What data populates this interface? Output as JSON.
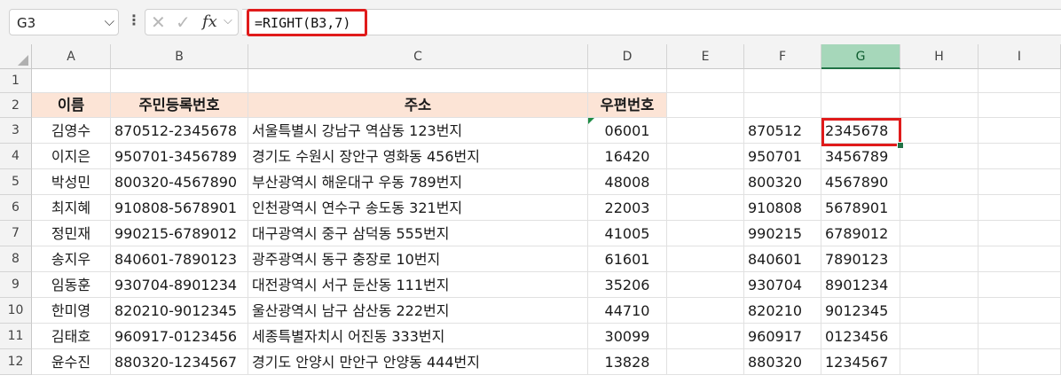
{
  "name_box": {
    "value": "G3"
  },
  "formula_bar": {
    "formula": "=RIGHT(B3,7)",
    "cancel_icon": "x-icon",
    "enter_icon": "check-icon",
    "function_icon": "fx"
  },
  "columns": [
    "A",
    "B",
    "C",
    "D",
    "E",
    "F",
    "G",
    "H",
    "I"
  ],
  "selected_column": "G",
  "rows": [
    "1",
    "2",
    "3",
    "4",
    "5",
    "6",
    "7",
    "8",
    "9",
    "10",
    "11",
    "12"
  ],
  "headers": {
    "name": "이름",
    "rrn": "주민등록번호",
    "address": "주소",
    "zip": "우편번호"
  },
  "records": [
    {
      "name": "김영수",
      "rrn": "870512-2345678",
      "address": "서울특별시 강남구 역삼동 123번지",
      "zip": "06001",
      "f": "870512",
      "g": "2345678"
    },
    {
      "name": "이지은",
      "rrn": "950701-3456789",
      "address": "경기도 수원시 장안구 영화동 456번지",
      "zip": "16420",
      "f": "950701",
      "g": "3456789"
    },
    {
      "name": "박성민",
      "rrn": "800320-4567890",
      "address": "부산광역시 해운대구 우동 789번지",
      "zip": "48008",
      "f": "800320",
      "g": "4567890"
    },
    {
      "name": "최지혜",
      "rrn": "910808-5678901",
      "address": "인천광역시 연수구 송도동 321번지",
      "zip": "22003",
      "f": "910808",
      "g": "5678901"
    },
    {
      "name": "정민재",
      "rrn": "990215-6789012",
      "address": "대구광역시 중구 삼덕동 555번지",
      "zip": "41005",
      "f": "990215",
      "g": "6789012"
    },
    {
      "name": "송지우",
      "rrn": "840601-7890123",
      "address": "광주광역시 동구 충장로 10번지",
      "zip": "61601",
      "f": "840601",
      "g": "7890123"
    },
    {
      "name": "임동훈",
      "rrn": "930704-8901234",
      "address": "대전광역시 서구 둔산동 111번지",
      "zip": "35206",
      "f": "930704",
      "g": "8901234"
    },
    {
      "name": "한미영",
      "rrn": "820210-9012345",
      "address": "울산광역시 남구 삼산동 222번지",
      "zip": "44710",
      "f": "820210",
      "g": "9012345"
    },
    {
      "name": "김태호",
      "rrn": "960917-0123456",
      "address": "세종특별자치시 어진동 333번지",
      "zip": "30099",
      "f": "960917",
      "g": "0123456"
    },
    {
      "name": "윤수진",
      "rrn": "880320-1234567",
      "address": "경기도 안양시 만안구 안양동 444번지",
      "zip": "13828",
      "f": "880320",
      "g": "1234567"
    }
  ],
  "colors": {
    "header_fill": "#fce4d6",
    "selected_col_header": "#a6d7ba",
    "highlight_border": "#e01b1b",
    "accent": "#217346"
  }
}
